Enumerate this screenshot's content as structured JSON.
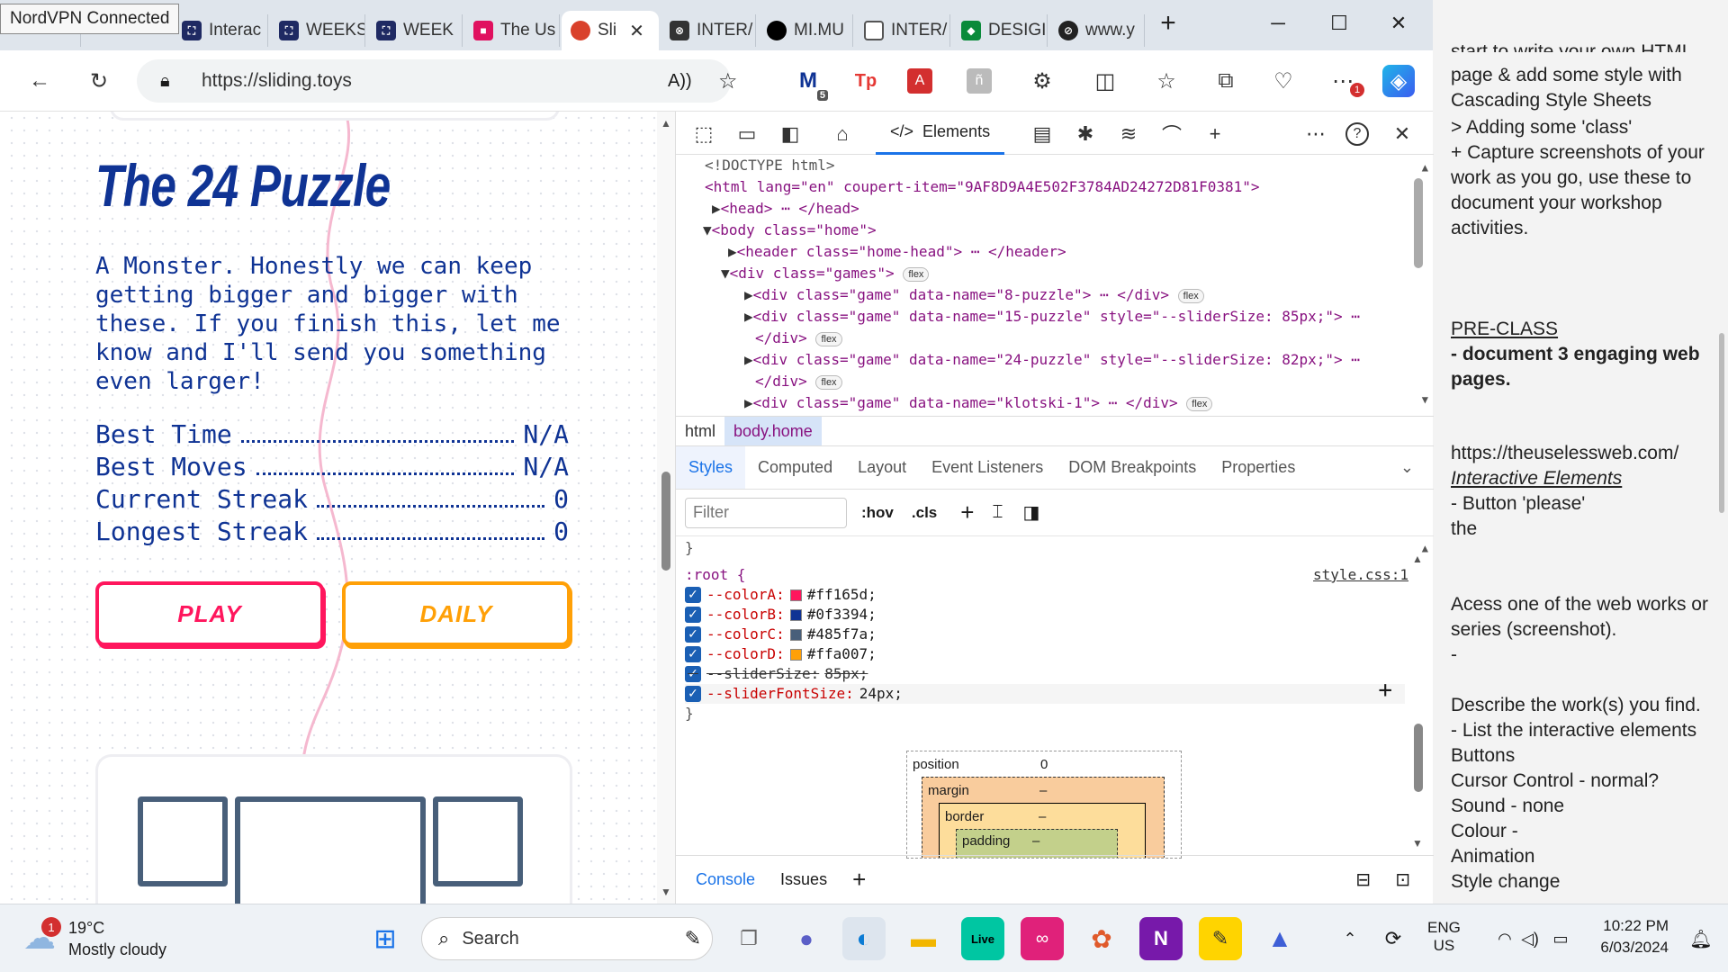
{
  "vpn_tooltip": "NordVPN Connected",
  "tabs": [
    {
      "label": "Interac",
      "color": "#1f2a63",
      "glyph": "⛶"
    },
    {
      "label": "WEEKS",
      "color": "#1f2a63",
      "glyph": "⛶"
    },
    {
      "label": "WEEK",
      "color": "#1f2a63",
      "glyph": "⛶"
    },
    {
      "label": "The Us",
      "color": "#e0115f",
      "glyph": "■"
    },
    {
      "label": "Sli",
      "color": "#d9412b",
      "glyph": "●",
      "active": true
    },
    {
      "label": "INTER/",
      "color": "#333333",
      "glyph": "⊗"
    },
    {
      "label": "MI.MU",
      "color": "#000000",
      "glyph": "●●"
    },
    {
      "label": "INTER/",
      "color": "#666666",
      "glyph": "▯"
    },
    {
      "label": "DESIGI",
      "color": "#0a8a3a",
      "glyph": "◆"
    },
    {
      "label": "www.y",
      "color": "#222222",
      "glyph": "⊘"
    }
  ],
  "new_tab": "+",
  "address": {
    "url": "https://sliding.toys"
  },
  "toolbar_badges": {
    "mail": "5",
    "more": "1"
  },
  "page": {
    "title": "The 24 Puzzle",
    "description": "A Monster. Honestly we can keep getting bigger and bigger with these. If you finish this, let me know and I'll send you something even larger!",
    "stats": [
      {
        "label": "Best Time",
        "value": "N/A"
      },
      {
        "label": "Best Moves",
        "value": "N/A"
      },
      {
        "label": "Current Streak",
        "value": "0"
      },
      {
        "label": "Longest Streak",
        "value": "0"
      }
    ],
    "play_label": "PLAY",
    "daily_label": "DAILY"
  },
  "devtools": {
    "elements_tab": "Elements",
    "crumbs": [
      "html",
      "body.home"
    ],
    "style_tabs": [
      "Styles",
      "Computed",
      "Layout",
      "Event Listeners",
      "DOM Breakpoints",
      "Properties"
    ],
    "filter_placeholder": "Filter",
    "hov": ":hov",
    "cls": ".cls",
    "root_selector": ":root {",
    "root_source": "style.css:1",
    "closing_brace": "}",
    "vars": [
      {
        "name": "--colorA:",
        "value": "#ff165d;",
        "swatch": "#ff165d"
      },
      {
        "name": "--colorB:",
        "value": "#0f3394;",
        "swatch": "#0f3394"
      },
      {
        "name": "--colorC:",
        "value": "#485f7a;",
        "swatch": "#485f7a"
      },
      {
        "name": "--colorD:",
        "value": "#ffa007;",
        "swatch": "#ffa007"
      },
      {
        "name": "--sliderSize:",
        "value": "85px;",
        "struck": true
      },
      {
        "name": "--sliderFontSize:",
        "value": "24px;"
      }
    ],
    "box": {
      "position": "position",
      "position_val": "0",
      "margin": "margin",
      "border": "border",
      "padding": "padding",
      "dash": "–"
    },
    "bottom_tabs": [
      "Console",
      "Issues"
    ],
    "dom_lines": [
      "<!DOCTYPE html>",
      "<html lang=\"en\" coupert-item=\"9AF8D9A4E502F3784AD24272D81F0381\">",
      "<head> ⋯ </head>",
      "<body class=\"home\">",
      "<header class=\"home-head\"> ⋯ </header>",
      "<div class=\"games\">",
      "<div class=\"game\" data-name=\"8-puzzle\"> ⋯ </div>",
      "<div class=\"game\" data-name=\"15-puzzle\" style=\"--sliderSize: 85px;\"> ⋯",
      "</div>",
      "<div class=\"game\" data-name=\"24-puzzle\" style=\"--sliderSize: 82px;\"> ⋯",
      "</div>",
      "<div class=\"game\" data-name=\"klotski-1\"> ⋯ </div>"
    ],
    "flex_pill": "flex"
  },
  "notes": {
    "top": [
      "start to write your own HTML",
      "page  & add some style with Cascading Style Sheets",
      "> Adding some 'class'",
      "+ Capture screenshots of your work as you go, use these to document your workshop activities."
    ],
    "preclass_heading": "PRE-CLASS",
    "preclass_item": "- document 3 engaging web pages.",
    "url": "https://theuselessweb.com/",
    "interactive": "Interactive Elements",
    "button_please": "- Button 'please'",
    "the": "the",
    "access": "Acess one of the web works or series (screenshot).",
    "dash": "-",
    "describe": "Describe the work(s) you find.",
    "list": [
      "- List the interactive elements",
      "Buttons",
      "Cursor Control - normal?",
      "Sound - none",
      "Colour -",
      "Animation",
      "Style change"
    ]
  },
  "taskbar": {
    "weather_temp": "19°C",
    "weather_desc": "Mostly cloudy",
    "weather_badge": "1",
    "search": "Search",
    "lang_top": "ENG",
    "lang_bottom": "US",
    "time": "10:22 PM",
    "date": "6/03/2024"
  },
  "colors": {
    "accent": "#0f3394",
    "play": "#ff165d",
    "daily": "#ffa007",
    "tile": "#485f7a"
  }
}
